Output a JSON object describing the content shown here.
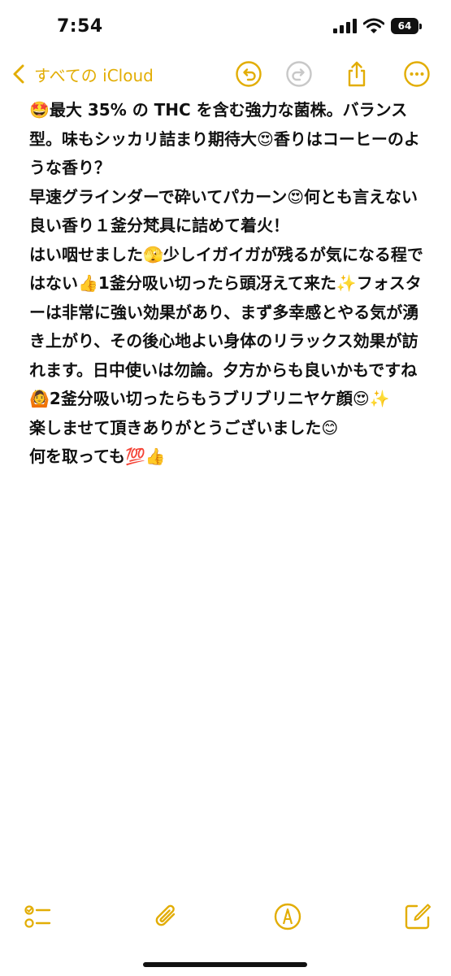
{
  "colors": {
    "accent": "#e2ad04",
    "text": "#111111",
    "background": "#ffffff"
  },
  "status_bar": {
    "time": "7:54",
    "battery": "64"
  },
  "nav": {
    "back_label": "すべての iCloud"
  },
  "note": {
    "lines": [
      "🤩最大 35% の THC を含む強力な菌株。バランス型。味もシッカリ詰まり期待大😍香りはコーヒーのような香り？",
      "早速グラインダーで砕いてパカーン😍何とも言えない良い香り１釜分梵具に詰めて着火！",
      "はい咽せました🫣少しイガイガが残るが気になる程ではない👍1釜分吸い切ったら頭冴えて来た✨フォスターは非常に強い効果があり、まず多幸感とやる気が湧き上がり、その後心地よい身体のリラックス効果が訪れます。日中使いは勿論。夕方からも良いかもですね🙆2釜分吸い切ったらもうブリブリニヤケ顔😍✨",
      "楽しませて頂きありがとうございました😊",
      "何を取っても💯👍"
    ]
  },
  "icons": {
    "back": "chevron-left-icon",
    "undo": "undo-icon",
    "redo": "redo-icon",
    "share": "share-icon",
    "more": "ellipsis-icon",
    "checklist": "checklist-icon",
    "attach": "paperclip-icon",
    "markup": "markup-pen-icon",
    "compose": "compose-icon"
  }
}
